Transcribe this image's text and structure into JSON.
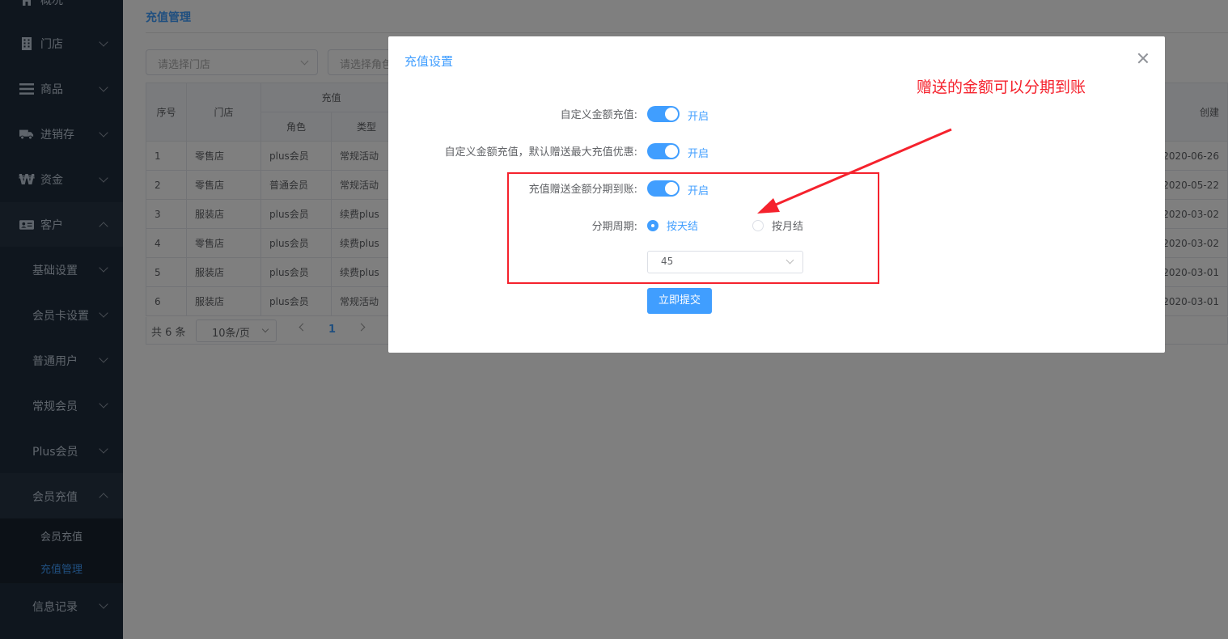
{
  "sidebar": {
    "items": [
      {
        "label": "概况",
        "icon": "home-icon"
      },
      {
        "label": "门店",
        "icon": "building-icon"
      },
      {
        "label": "商品",
        "icon": "list-icon"
      },
      {
        "label": "进销存",
        "icon": "truck-icon"
      },
      {
        "label": "资金",
        "icon": "won-icon"
      },
      {
        "label": "客户",
        "icon": "id-card-icon"
      }
    ],
    "sub_items": [
      "基础设置",
      "会员卡设置",
      "普通用户",
      "常规会员",
      "Plus会员",
      "会员充值"
    ],
    "leaf_items": [
      "会员充值",
      "充值管理"
    ],
    "last_item": "信息记录"
  },
  "main": {
    "page_title": "充值管理",
    "filters": {
      "store_placeholder": "请选择门店",
      "role_placeholder": "请选择角色"
    },
    "table": {
      "headers": {
        "index": "序号",
        "store": "门店",
        "recharge_group": "充值",
        "role": "角色",
        "type": "类型",
        "created": "创建"
      },
      "rows": [
        {
          "index": "1",
          "store": "零售店",
          "role": "plus会员",
          "type": "常规活动",
          "created": "2020-06-26"
        },
        {
          "index": "2",
          "store": "零售店",
          "role": "普通会员",
          "type": "常规活动",
          "created": "2020-05-22"
        },
        {
          "index": "3",
          "store": "服装店",
          "role": "plus会员",
          "type": "续费plus",
          "created": "2020-03-02"
        },
        {
          "index": "4",
          "store": "零售店",
          "role": "plus会员",
          "type": "续费plus",
          "created": "2020-03-02"
        },
        {
          "index": "5",
          "store": "服装店",
          "role": "plus会员",
          "type": "续费plus",
          "created": "2020-03-01"
        },
        {
          "index": "6",
          "store": "服装店",
          "role": "plus会员",
          "type": "常规活动",
          "created": "2020-03-01"
        }
      ]
    },
    "pager": {
      "total": "共 6 条",
      "page_size": "10条/页",
      "current_page": "1"
    }
  },
  "dialog": {
    "title": "充值设置",
    "fields": {
      "custom_amount_label": "自定义金额充值:",
      "custom_amount_state": "开启",
      "default_gift_label": "自定义金额充值，默认赠送最大充值优惠:",
      "default_gift_state": "开启",
      "installment_label": "充值赠送金额分期到账:",
      "installment_state": "开启",
      "period_label": "分期周期:",
      "period_daily": "按天结",
      "period_monthly": "按月结",
      "period_value": "45"
    },
    "submit_label": "立即提交"
  },
  "annotation": {
    "text": "赠送的金额可以分期到账"
  },
  "colors": {
    "primary": "#409eff",
    "sidebar_bg": "#1f2d3d",
    "annotation_red": "#f5222d"
  }
}
